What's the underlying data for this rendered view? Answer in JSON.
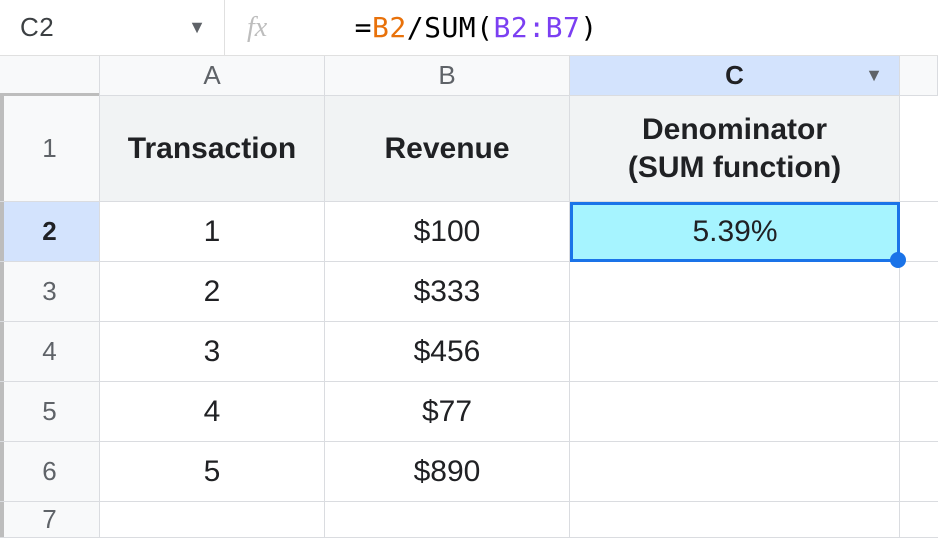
{
  "namebox": {
    "ref": "C2"
  },
  "formula": {
    "eq": "=",
    "ref1": "B2",
    "op": "/",
    "fn_open": "SUM(",
    "range": "B2:B7",
    "fn_close": ")"
  },
  "columns": {
    "A": "A",
    "B": "B",
    "C": "C"
  },
  "headers": {
    "A": "Transaction",
    "B": "Revenue",
    "C_line1": "Denominator",
    "C_line2": "(SUM function)"
  },
  "rows": [
    {
      "n": "1"
    },
    {
      "n": "2",
      "A": "1",
      "B": "$100",
      "C": "5.39%"
    },
    {
      "n": "3",
      "A": "2",
      "B": "$333"
    },
    {
      "n": "4",
      "A": "3",
      "B": "$456"
    },
    {
      "n": "5",
      "A": "4",
      "B": "$77"
    },
    {
      "n": "6",
      "A": "5",
      "B": "$890"
    },
    {
      "n": "7"
    }
  ],
  "chart_data": {
    "type": "table",
    "title": "Revenue share computed with SUM denominator",
    "columns": [
      "Transaction",
      "Revenue",
      "Denominator (SUM function)"
    ],
    "data": [
      {
        "Transaction": 1,
        "Revenue": 100,
        "Denominator (SUM function)": 0.0539
      },
      {
        "Transaction": 2,
        "Revenue": 333
      },
      {
        "Transaction": 3,
        "Revenue": 456
      },
      {
        "Transaction": 4,
        "Revenue": 77
      },
      {
        "Transaction": 5,
        "Revenue": 890
      }
    ],
    "formula_C2": "=B2/SUM(B2:B7)"
  }
}
